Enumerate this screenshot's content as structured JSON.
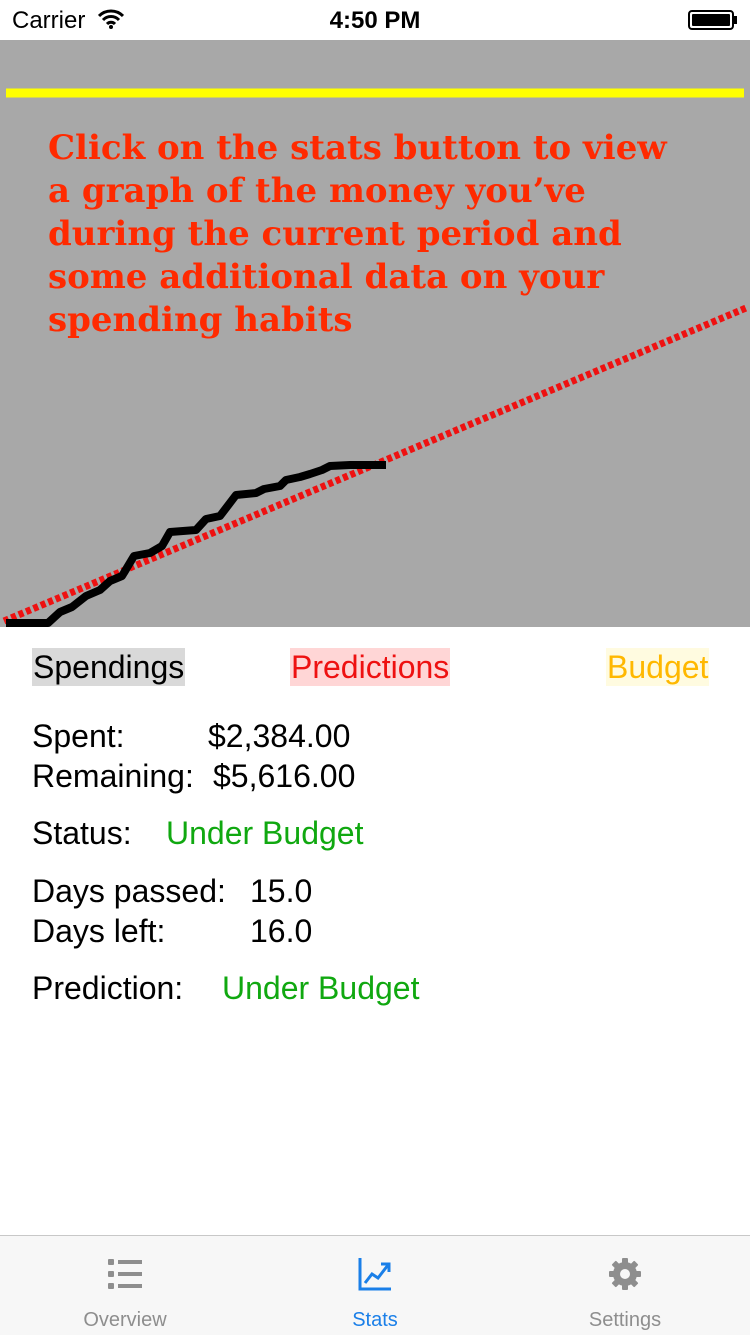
{
  "status_bar": {
    "carrier": "Carrier",
    "time": "4:50 PM",
    "icons": [
      "wifi-icon",
      "battery-icon"
    ]
  },
  "graph": {
    "tip_text": "Click on the stats button to view a graph of the money you’ve during the current period and some additional data on your spending habits",
    "colors": {
      "background": "#a8a8a8",
      "spendings_line": "#000000",
      "predictions_line": "#ee1111",
      "budget_line": "#ffff00",
      "tip_text": "#ff2a00"
    }
  },
  "legend": {
    "spendings": "Spendings",
    "predictions": "Predictions",
    "budget": "Budget"
  },
  "stats": {
    "spent_label": "Spent:",
    "spent_value": "$2,384.00",
    "remaining_label": "Remaining:",
    "remaining_value": "$5,616.00",
    "status_label": "Status:",
    "status_value": "Under Budget",
    "days_passed_label": "Days passed:",
    "days_passed_value": "15.0",
    "days_left_label": "Days left:",
    "days_left_value": "16.0",
    "prediction_label": "Prediction:",
    "prediction_value": "Under Budget",
    "status_color": "#10a810"
  },
  "tab_bar": {
    "tabs": [
      {
        "label": "Overview",
        "icon": "list-icon",
        "active": false
      },
      {
        "label": "Stats",
        "icon": "chart-icon",
        "active": true
      },
      {
        "label": "Settings",
        "icon": "gear-icon",
        "active": false
      }
    ],
    "active_color": "#1a7fe8",
    "inactive_color": "#8e8e8e"
  }
}
